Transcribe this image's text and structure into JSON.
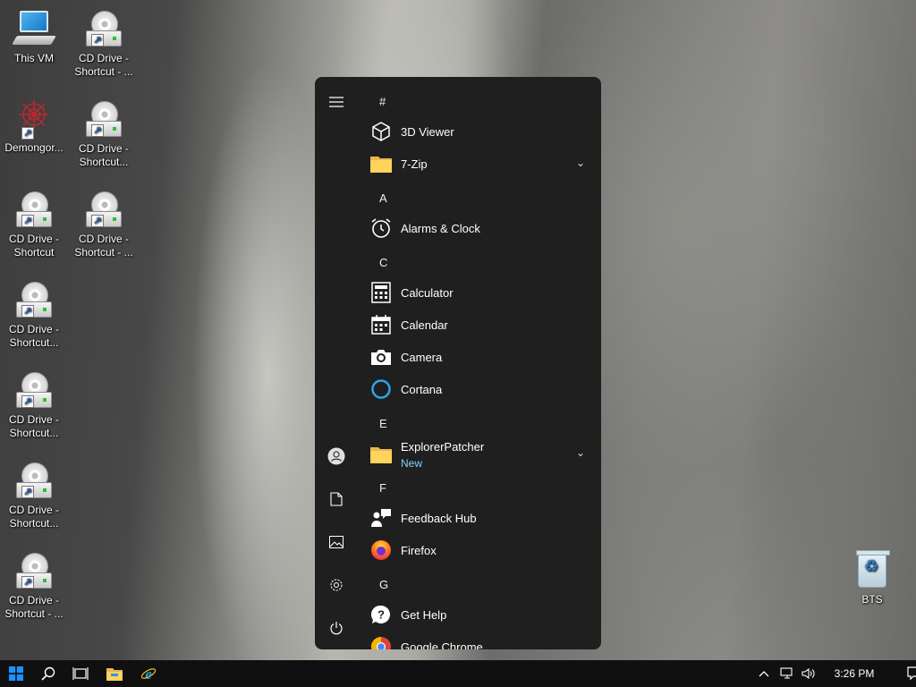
{
  "desktop": {
    "icons": [
      {
        "label": "This VM",
        "icon": "computer-icon"
      },
      {
        "label": "CD Drive - Shortcut - ...",
        "icon": "cd-drive-icon"
      },
      {
        "label": "Demongor...",
        "icon": "demongor-icon"
      },
      {
        "label": "CD Drive - Shortcut...",
        "icon": "cd-drive-icon"
      },
      {
        "label": "CD Drive - Shortcut",
        "icon": "cd-drive-icon"
      },
      {
        "label": "CD Drive - Shortcut - ...",
        "icon": "cd-drive-icon"
      },
      {
        "label": "CD Drive - Shortcut...",
        "icon": "cd-drive-icon"
      },
      {
        "label": "CD Drive - Shortcut...",
        "icon": "cd-drive-icon"
      },
      {
        "label": "CD Drive - Shortcut...",
        "icon": "cd-drive-icon"
      },
      {
        "label": "CD Drive - Shortcut - ...",
        "icon": "cd-drive-icon"
      },
      {
        "label": "BTS",
        "icon": "recycle-bin-icon"
      }
    ]
  },
  "start_menu": {
    "rail": [
      "hamburger-menu-icon",
      "user-account-icon",
      "documents-icon",
      "pictures-icon",
      "settings-icon",
      "power-icon"
    ],
    "headers": [
      "#",
      "A",
      "C",
      "E",
      "F",
      "G"
    ],
    "apps": [
      {
        "name": "3D Viewer",
        "icon": "3d-viewer-icon"
      },
      {
        "name": "7-Zip",
        "icon": "folder-icon",
        "expandable": true
      },
      {
        "name": "Alarms & Clock",
        "icon": "alarm-clock-icon"
      },
      {
        "name": "Calculator",
        "icon": "calculator-icon"
      },
      {
        "name": "Calendar",
        "icon": "calendar-icon"
      },
      {
        "name": "Camera",
        "icon": "camera-icon"
      },
      {
        "name": "Cortana",
        "icon": "cortana-icon"
      },
      {
        "name": "ExplorerPatcher",
        "icon": "folder-icon",
        "badge": "New",
        "expandable": true
      },
      {
        "name": "Feedback Hub",
        "icon": "feedback-hub-icon"
      },
      {
        "name": "Firefox",
        "icon": "firefox-icon"
      },
      {
        "name": "Get Help",
        "icon": "get-help-icon"
      },
      {
        "name": "Google Chrome",
        "icon": "chrome-icon"
      }
    ]
  },
  "taskbar": {
    "buttons": [
      "start-icon",
      "search-icon",
      "task-view-icon",
      "file-explorer-icon",
      "internet-explorer-icon"
    ],
    "tray": {
      "clock": "3:26 PM"
    }
  },
  "colors": {
    "accent": "#1e90ff",
    "start_bg": "#1f1f1f",
    "taskbar_bg": "#101010",
    "badge": "#7fd1ff"
  }
}
